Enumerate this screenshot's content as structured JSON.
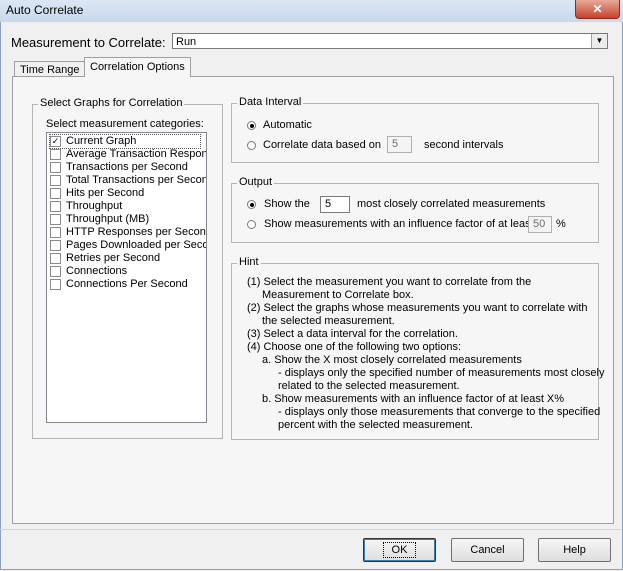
{
  "window": {
    "title": "Auto Correlate",
    "close_label": "✕"
  },
  "measurement": {
    "label": "Measurement to Correlate:",
    "value": "Run"
  },
  "tabs": [
    {
      "label": "Time Range",
      "active": false
    },
    {
      "label": "Correlation Options",
      "active": true
    }
  ],
  "graphs": {
    "group_title": "Select Graphs for Correlation",
    "list_label": "Select measurement categories:",
    "items": [
      {
        "label": "Current Graph",
        "checked": true
      },
      {
        "label": "Average Transaction Respon",
        "checked": false
      },
      {
        "label": "Transactions per Second",
        "checked": false
      },
      {
        "label": "Total Transactions per Secon",
        "checked": false
      },
      {
        "label": "Hits per Second",
        "checked": false
      },
      {
        "label": "Throughput",
        "checked": false
      },
      {
        "label": "Throughput (MB)",
        "checked": false
      },
      {
        "label": "HTTP Responses per Second",
        "checked": false
      },
      {
        "label": "Pages Downloaded per Seco",
        "checked": false
      },
      {
        "label": "Retries per Second",
        "checked": false
      },
      {
        "label": "Connections",
        "checked": false
      },
      {
        "label": "Connections Per Second",
        "checked": false
      }
    ]
  },
  "data_interval": {
    "title": "Data Interval",
    "automatic_label": "Automatic",
    "correlate_label": "Correlate data based on",
    "interval_value": "5",
    "interval_suffix": "second intervals"
  },
  "output": {
    "title": "Output",
    "show_label": "Show the",
    "count_value": "5",
    "count_suffix": "most closely correlated measurements",
    "influence_label": "Show measurements with an influence factor of at least",
    "influence_value": "50",
    "influence_suffix": "%"
  },
  "hint": {
    "title": "Hint",
    "lines": [
      "(1) Select the measurement you want to correlate from the",
      "Measurement to Correlate box.",
      "(2) Select the graphs whose measurements you want to correlate with",
      "the selected measurement.",
      "(3) Select a data interval for the correlation.",
      "(4) Choose one of the following two options:",
      "a. Show the X most closely correlated measurements",
      "- displays only the specified number of measurements most closely",
      "related to the selected measurement.",
      "b. Show measurements with an influence factor of at least X%",
      "- displays only those measurements that converge to the specified",
      "percent with the selected measurement."
    ]
  },
  "buttons": {
    "ok": "OK",
    "cancel": "Cancel",
    "help": "Help"
  }
}
